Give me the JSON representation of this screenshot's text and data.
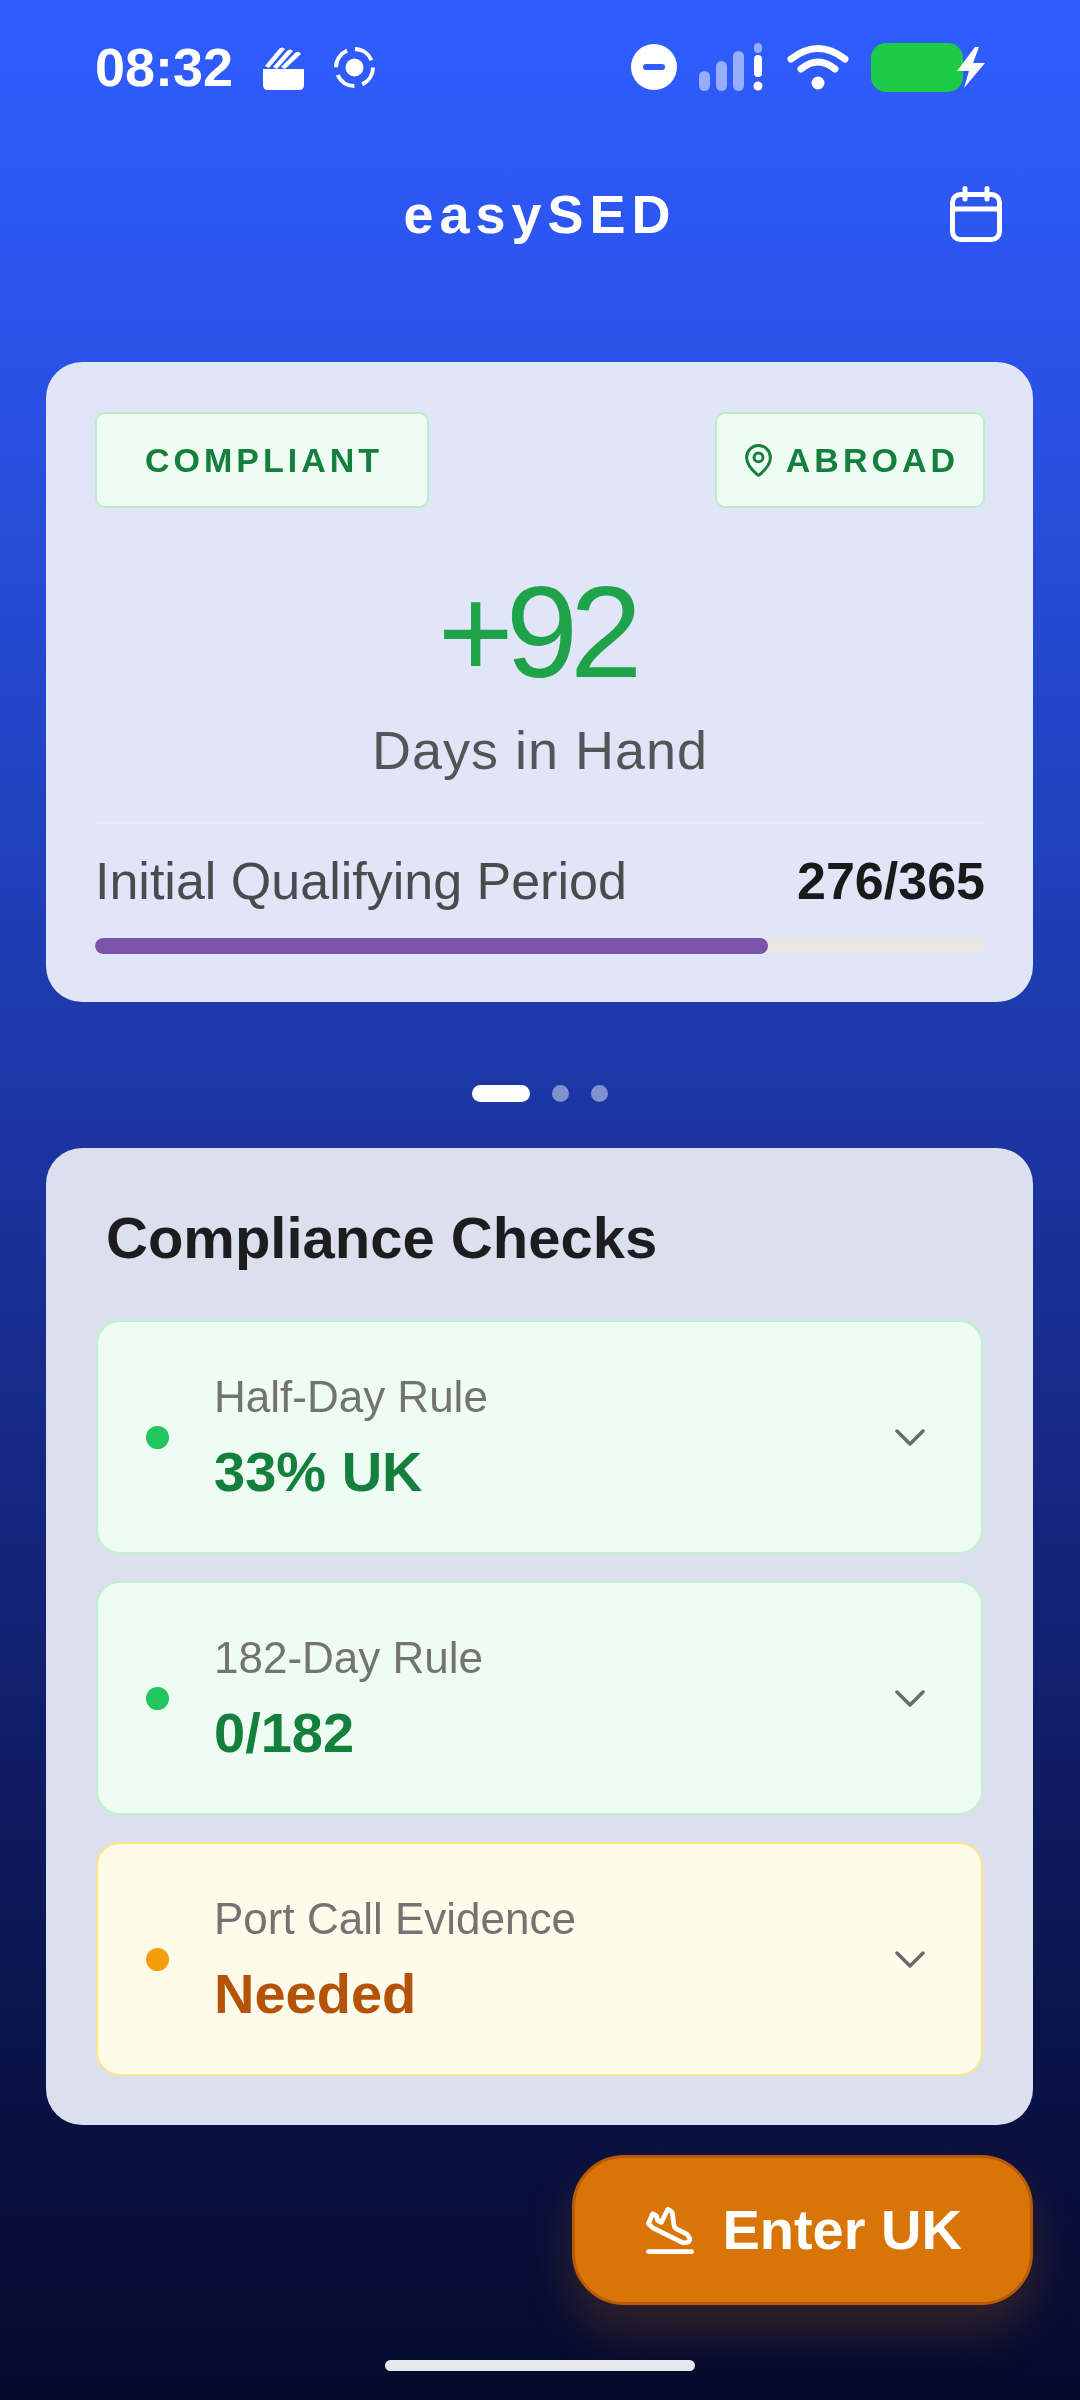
{
  "status_bar": {
    "time": "08:32"
  },
  "header": {
    "title": "easySED"
  },
  "summary_card": {
    "status_badge": "COMPLIANT",
    "location_badge": "ABROAD",
    "days_value": "+92",
    "days_label": "Days in Hand",
    "period": {
      "label": "Initial Qualifying Period",
      "count": "276/365",
      "level": 0.756
    }
  },
  "pager": {
    "dots": [
      {
        "selected": true
      },
      {
        "selected": false
      },
      {
        "selected": false
      }
    ]
  },
  "compliance_checks": {
    "title": "Compliance Checks",
    "items": [
      {
        "label": "Half-Day Rule",
        "value": "33% UK",
        "kind": "ok",
        "color": "#22c55e",
        "expanded": false
      },
      {
        "label": "182-Day Rule",
        "value": "0/182",
        "kind": "ok",
        "color": "#22c55e",
        "expanded": false
      },
      {
        "label": "Port Call Evidence",
        "value": "Needed",
        "kind": "warning",
        "color": "#f59e0b",
        "expanded": false
      }
    ]
  },
  "primary_action": {
    "label": "Enter UK"
  }
}
